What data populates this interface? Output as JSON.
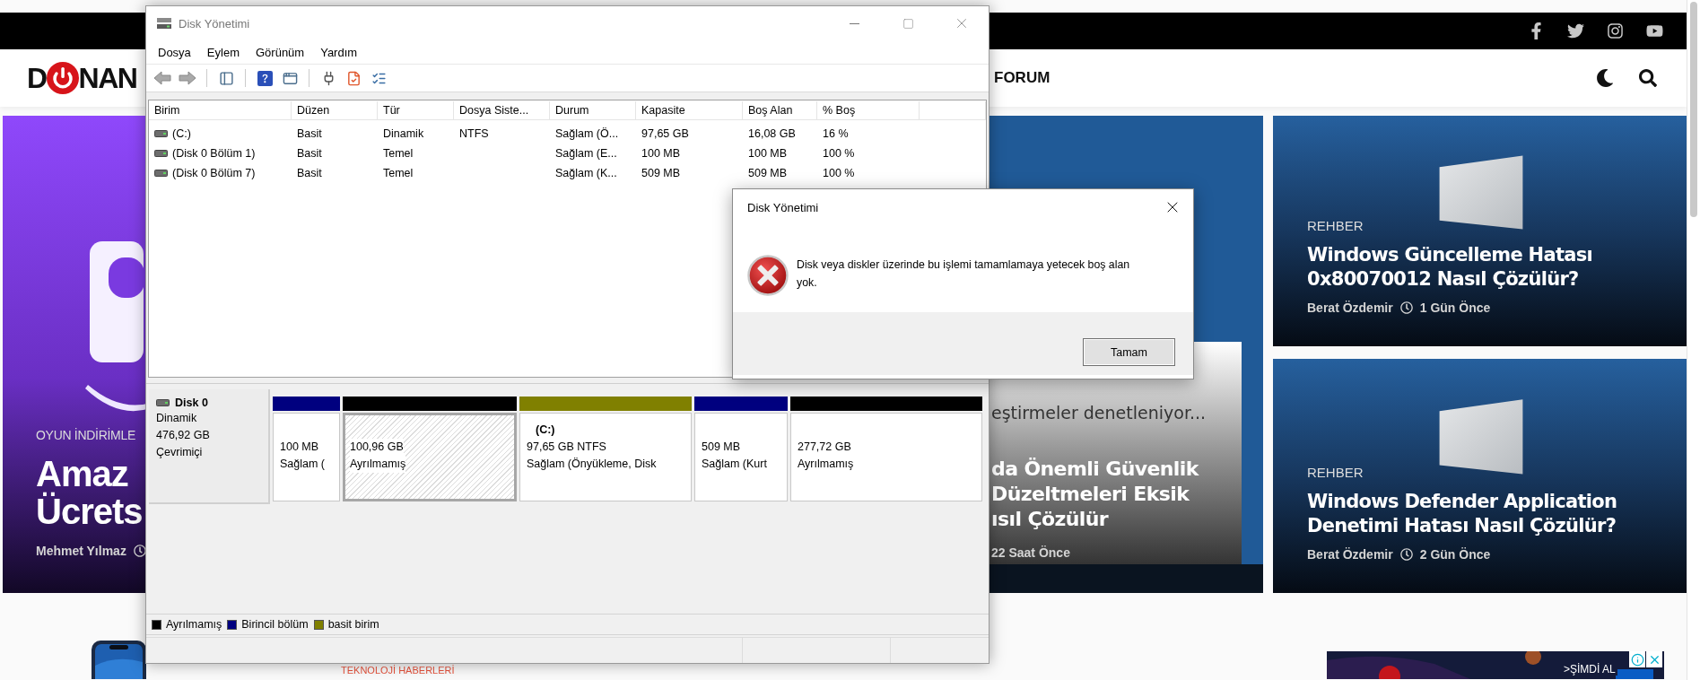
{
  "site": {
    "logo": {
      "letter": "D",
      "text": "NAN"
    },
    "nav": [
      "FORUM"
    ],
    "cards": [
      {
        "kind": "feature",
        "category": "OYUN İNDİRİMLE",
        "title_lines": [
          "Amaz",
          "Ücrets"
        ],
        "author": "Mehmet Yılmaz"
      },
      {
        "kind": "partial",
        "caption": "eştirmeler denetleniyor...",
        "title_lines": [
          "da Önemli Güvenlik",
          "Düzeltmeleri Eksik",
          "ısıl Çözülür"
        ],
        "time": "22 Saat Önce"
      },
      {
        "kind": "side",
        "category": "REHBER",
        "title_lines": [
          "Windows Güncelleme Hatası",
          "0x80070012 Nasıl Çözülür?"
        ],
        "author": "Berat Özdemir",
        "time": "1 Gün Önce"
      },
      {
        "kind": "side",
        "category": "REHBER",
        "title_lines": [
          "Windows Defender Application",
          "Denetimi Hatası Nasıl Çözülür?"
        ],
        "author": "Berat Özdemir",
        "time": "2 Gün Önce"
      }
    ],
    "section_title": "TEKNOLOJİ HABERLERİ",
    "ad": {
      "cta": ">ŞİMDİ AL"
    }
  },
  "main_window": {
    "title": "Disk Yönetimi",
    "menu": [
      "Dosya",
      "Eylem",
      "Görünüm",
      "Yardım"
    ],
    "volumes": {
      "columns": [
        "Birim",
        "Düzen",
        "Tür",
        "Dosya Siste...",
        "Durum",
        "Kapasite",
        "Boş Alan",
        "% Boş"
      ],
      "rows": [
        {
          "cells": [
            "(C:)",
            "Basit",
            "Dinamik",
            "NTFS",
            "Sağlam (Ö...",
            "97,65 GB",
            "16,08 GB",
            "16 %"
          ]
        },
        {
          "cells": [
            "(Disk 0 Bölüm 1)",
            "Basit",
            "Temel",
            "",
            "Sağlam (E...",
            "100 MB",
            "100 MB",
            "100 %"
          ]
        },
        {
          "cells": [
            "(Disk 0 Bölüm 7)",
            "Basit",
            "Temel",
            "",
            "Sağlam (K...",
            "509 MB",
            "509 MB",
            "100 %"
          ]
        }
      ]
    },
    "disk": {
      "name": "Disk 0",
      "type": "Dinamik",
      "size": "476,92 GB",
      "status": "Çevrimiçi",
      "partitions": [
        {
          "kind": "primary",
          "selected": false,
          "lines": [
            "100 MB",
            "Sağlam ("
          ]
        },
        {
          "kind": "unallocated",
          "selected": true,
          "lines": [
            "100,96 GB",
            "Ayrılmamış"
          ]
        },
        {
          "kind": "simple",
          "selected": false,
          "name": "(C:)",
          "lines": [
            "97,65 GB NTFS",
            "Sağlam (Önyükleme, Disk"
          ]
        },
        {
          "kind": "primary",
          "selected": false,
          "lines": [
            "509 MB",
            "Sağlam (Kurt"
          ]
        },
        {
          "kind": "unallocated",
          "selected": false,
          "lines": [
            "277,72 GB",
            "Ayrılmamış"
          ]
        }
      ]
    },
    "legend": [
      {
        "kind": "unallocated",
        "label": "Ayrılmamış"
      },
      {
        "kind": "primary",
        "label": "Birincil bölüm"
      },
      {
        "kind": "simple",
        "label": "basit birim"
      }
    ]
  },
  "dialog": {
    "title": "Disk Yönetimi",
    "message": "Disk veya diskler üzerinde bu işlemi tamamlamaya yetecek boş alan yok.",
    "button": "Tamam"
  }
}
